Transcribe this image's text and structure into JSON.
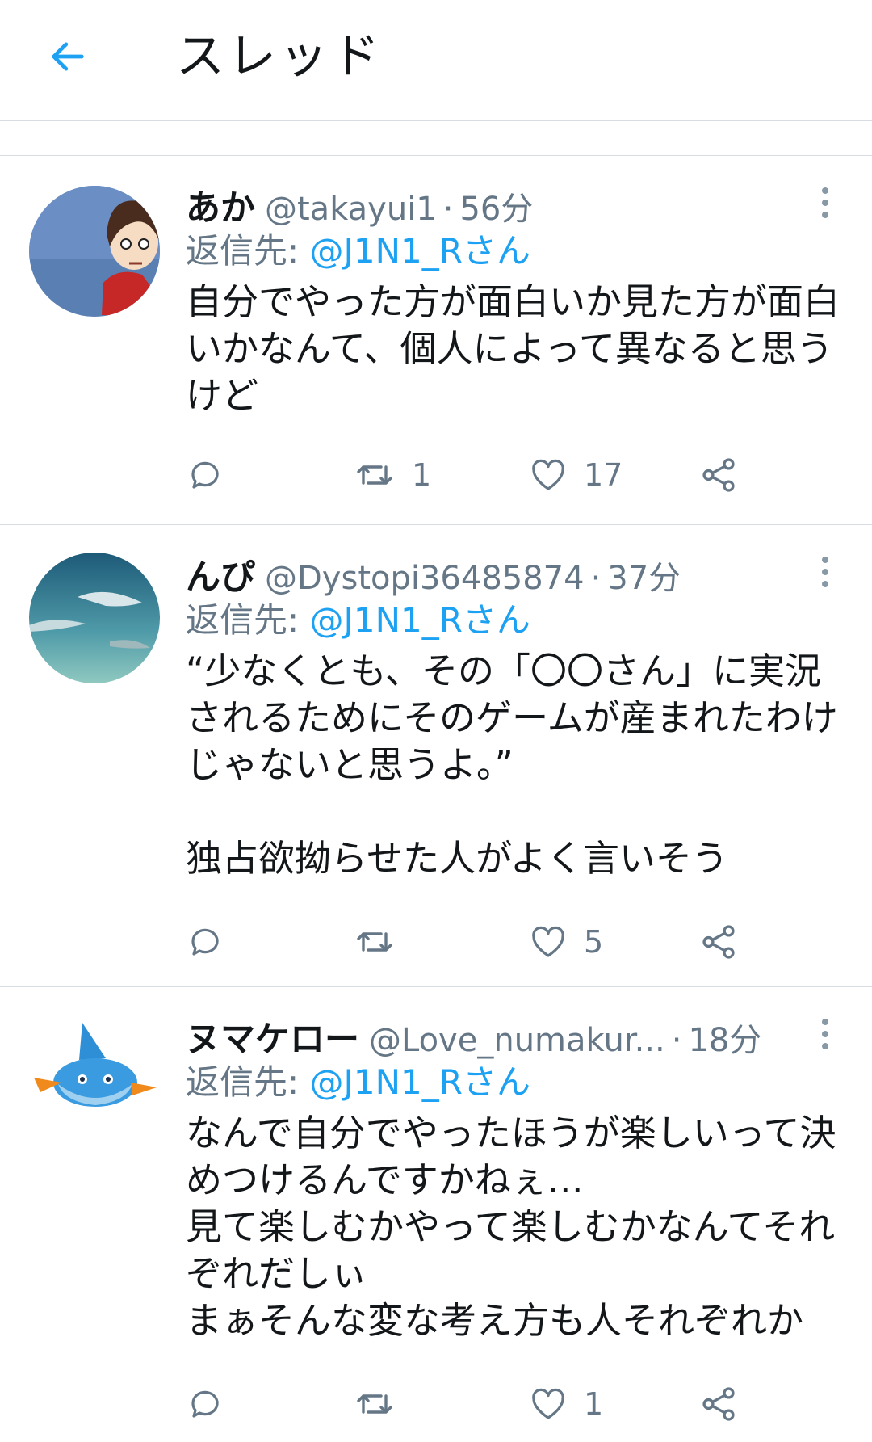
{
  "header": {
    "title": "スレッド",
    "back_icon": "arrow-left-icon",
    "accent": "#1da1f2"
  },
  "tweets": [
    {
      "name": "あか",
      "handle": "@takayui1",
      "time": "56分",
      "reply_prefix": "返信先: ",
      "reply_to": "@J1N1_Rさん",
      "text": "自分でやった方が面白いか見た方が面白\nいかなんて、個人によって異なると思う\nけど",
      "replies": "",
      "retweets": "1",
      "likes": "17"
    },
    {
      "name": "んぴ",
      "handle": "@Dystopi36485874",
      "time": "37分",
      "reply_prefix": "返信先: ",
      "reply_to": "@J1N1_Rさん",
      "text": "“少なくとも、その「〇〇さん」に実況\nされるためにそのゲームが産まれたわけ\nじゃないと思うよ。”\n\n独占欲拗らせた人がよく言いそう",
      "replies": "",
      "retweets": "",
      "likes": "5"
    },
    {
      "name": "ヌマケロー",
      "handle": "@Love_numakur...",
      "time": "18分",
      "reply_prefix": "返信先: ",
      "reply_to": "@J1N1_Rさん",
      "text": "なんで自分でやったほうが楽しいって決\nめつけるんですかねぇ…\n見て楽しむかやって楽しむかなんてそれ\nぞれだしぃ\nまぁそんな変な考え方も人それぞれか",
      "replies": "",
      "retweets": "",
      "likes": "1"
    }
  ],
  "icons": {
    "reply": "reply-bubble-icon",
    "retweet": "retweet-icon",
    "like": "heart-icon",
    "share": "share-icon",
    "more": "more-vertical-icon"
  }
}
